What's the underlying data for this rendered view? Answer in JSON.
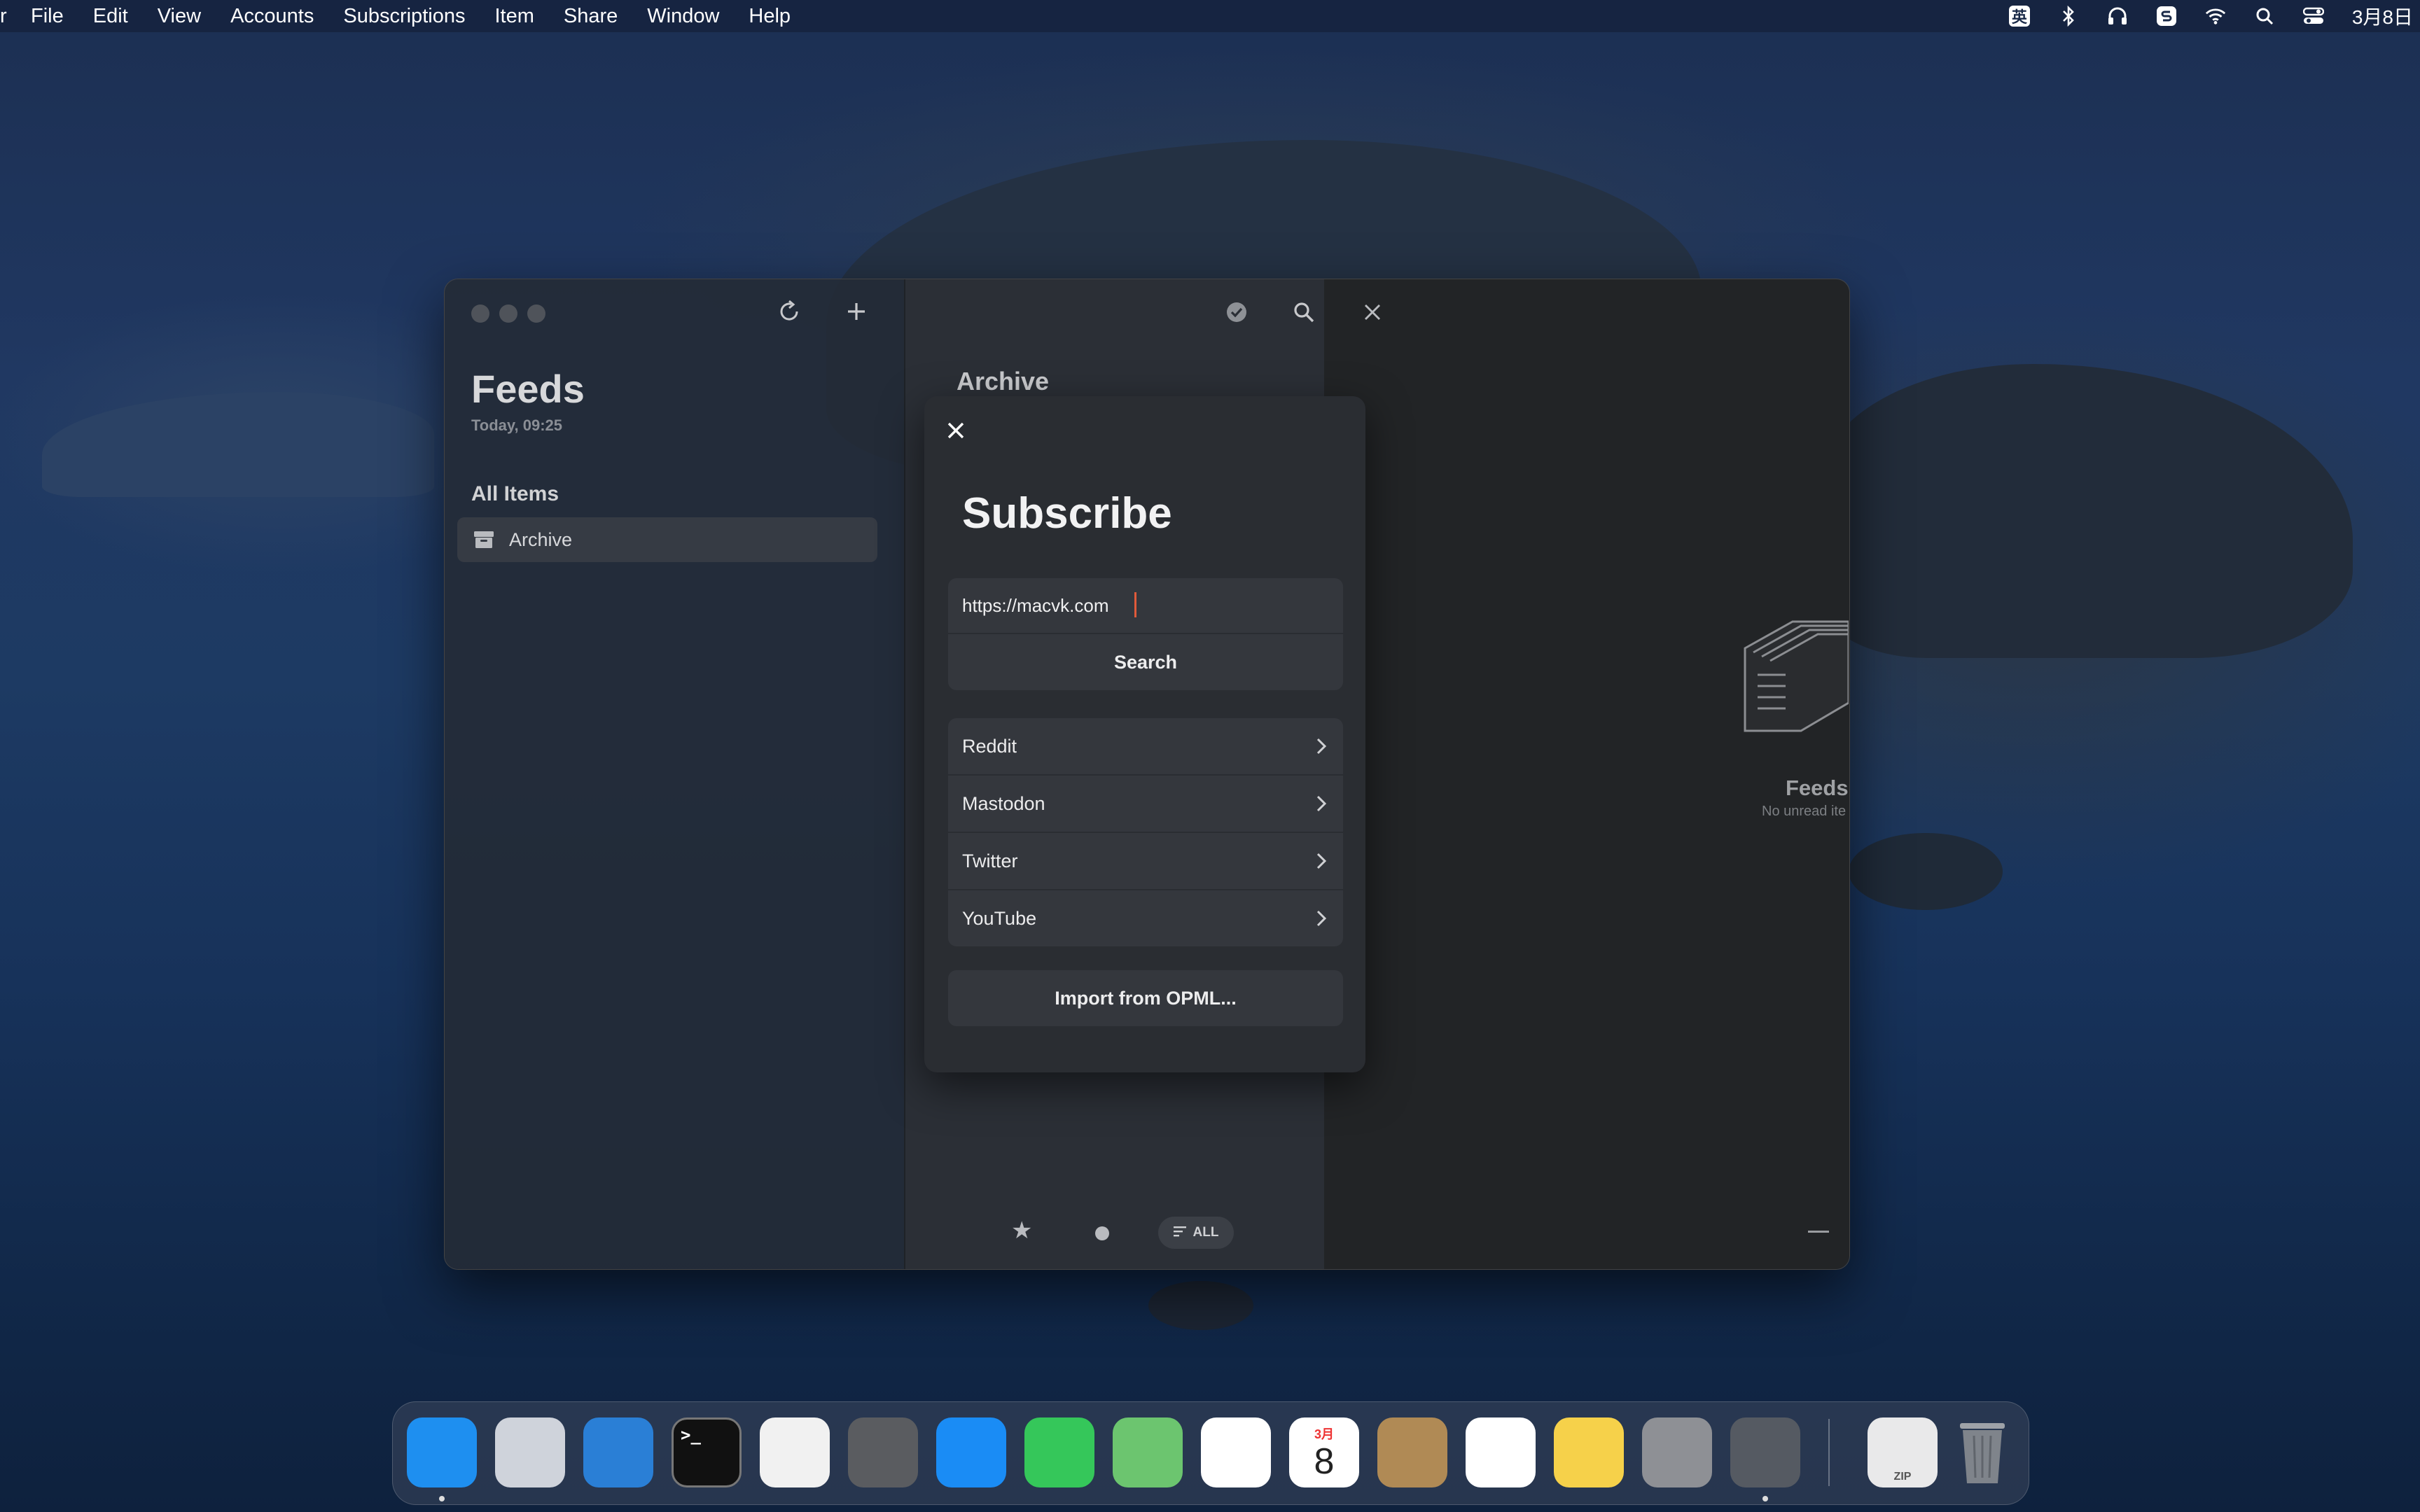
{
  "menubar": {
    "app_menu": "r",
    "items": [
      "File",
      "Edit",
      "View",
      "Accounts",
      "Subscriptions",
      "Item",
      "Share",
      "Window",
      "Help"
    ],
    "input_indicator": "英",
    "clock": "3月8日",
    "status_icons": [
      "input-method-icon",
      "bluetooth-icon",
      "headphones-icon",
      "s-app-icon",
      "wifi-icon",
      "search-icon",
      "control-center-icon"
    ]
  },
  "sidebar": {
    "title": "Feeds",
    "subtitle": "Today, 09:25",
    "section": "All Items",
    "items": [
      {
        "label": "Archive",
        "icon": "archive-box-icon",
        "selected": true
      }
    ]
  },
  "middle": {
    "title": "Archive",
    "filters": {
      "starred": "★",
      "all_label": "ALL"
    }
  },
  "detail": {
    "empty_title": "Feeds",
    "empty_subtitle": "No unread ite"
  },
  "dialog": {
    "title": "Subscribe",
    "url_value": "https://macvk.com",
    "search_label": "Search",
    "services": [
      {
        "label": "Reddit"
      },
      {
        "label": "Mastodon"
      },
      {
        "label": "Twitter"
      },
      {
        "label": "YouTube"
      }
    ],
    "import_label": "Import from OPML..."
  },
  "dock": {
    "apps": [
      {
        "name": "finder-icon",
        "color": "#1e8ff0",
        "running": true
      },
      {
        "name": "launchpad-icon",
        "color": "#cfd3db",
        "running": false
      },
      {
        "name": "edge-icon",
        "color": "#2a7fd6",
        "running": false
      },
      {
        "name": "terminal-icon",
        "color": "#111111",
        "running": false
      },
      {
        "name": "chrome-icon",
        "color": "#f1f1f1",
        "running": false
      },
      {
        "name": "calculator-icon",
        "color": "#5a5c60",
        "running": false
      },
      {
        "name": "app-store-icon",
        "color": "#1a8cf5",
        "running": false
      },
      {
        "name": "messages-icon",
        "color": "#35c75a",
        "running": false
      },
      {
        "name": "maps-icon",
        "color": "#6cc56f",
        "running": false
      },
      {
        "name": "photos-icon",
        "color": "#ffffff",
        "running": false
      },
      {
        "name": "calendar-icon",
        "color": "#ffffff",
        "running": false
      },
      {
        "name": "contacts-icon",
        "color": "#b08a55",
        "running": false
      },
      {
        "name": "reminders-icon",
        "color": "#ffffff",
        "running": false
      },
      {
        "name": "notes-icon",
        "color": "#f6d14a",
        "running": false
      },
      {
        "name": "system-settings-icon",
        "color": "#8e9095",
        "running": false
      },
      {
        "name": "reeder-icon",
        "color": "#555a62",
        "running": true
      }
    ],
    "calendar_month": "3月",
    "calendar_day": "8",
    "terminal_prompt": ">_",
    "archive_label": "ZIP"
  }
}
